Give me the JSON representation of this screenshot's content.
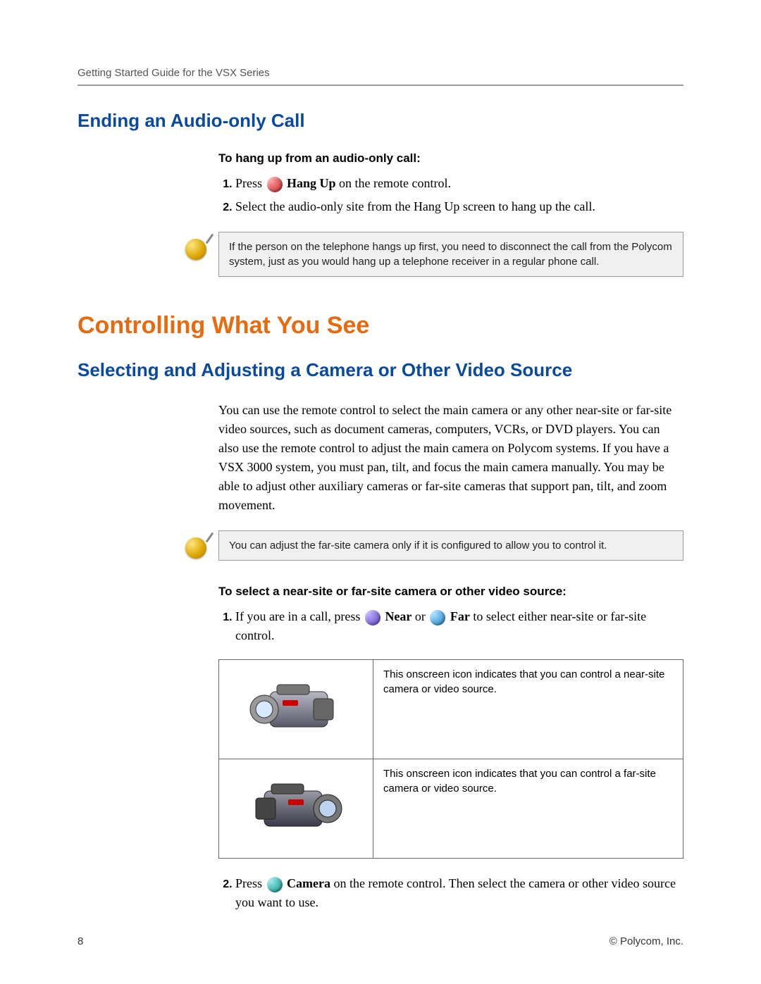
{
  "header": {
    "running_head": "Getting Started Guide for the VSX Series"
  },
  "section1": {
    "title": "Ending an Audio-only Call",
    "sub": "To hang up from an audio-only call:",
    "step1_a": "Press ",
    "step1_b": " Hang Up",
    "step1_c": " on the remote control.",
    "step2": "Select the audio-only site from the Hang Up screen to hang up the call.",
    "note": "If the person on the telephone hangs up first, you need to disconnect the call from the Polycom system, just as you would hang up a telephone receiver in a regular phone call."
  },
  "section2": {
    "title": "Controlling What You See",
    "subtitle": "Selecting and Adjusting a Camera or Other Video Source",
    "para": "You can use the remote control to select the main camera or any other near-site or far-site video sources, such as document cameras, computers, VCRs, or DVD players. You can also use the remote control to adjust the main camera on Polycom systems. If you have a VSX 3000 system, you must pan, tilt, and focus the main camera manually. You may be able to adjust other auxiliary cameras or far-site cameras that support pan, tilt, and zoom movement.",
    "note": "You can adjust the far-site camera only if it is configured to allow you to control it.",
    "sub2": "To select a near-site or far-site camera or other video source:",
    "s2_step1_a": "If you are in a call, press ",
    "s2_step1_near": " Near",
    "s2_step1_or": " or ",
    "s2_step1_far": " Far",
    "s2_step1_b": " to select either near-site or far-site control.",
    "table_row1": "This onscreen icon indicates that you can control a near-site camera or video source.",
    "table_row2": "This onscreen icon indicates that you can control a far-site camera or video source.",
    "s2_step2_a": "Press ",
    "s2_step2_cam": " Camera",
    "s2_step2_b": " on the remote control. Then select the camera or other video source you want to use."
  },
  "footer": {
    "page": "8",
    "copyright": "© Polycom, Inc."
  }
}
